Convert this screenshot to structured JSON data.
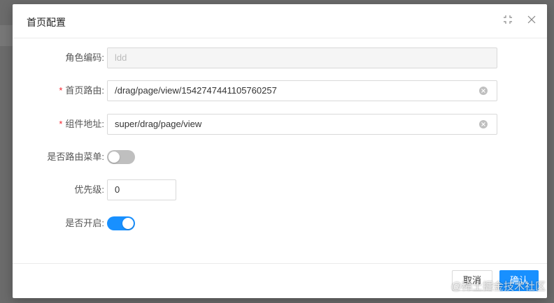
{
  "dialog": {
    "title": "首页配置"
  },
  "form": {
    "role_code": {
      "label": "角色编码:",
      "value": "ldd",
      "disabled": true
    },
    "home_route": {
      "label": "首页路由:",
      "required": true,
      "value": "/drag/page/view/1542747441105760257"
    },
    "component_address": {
      "label": "组件地址:",
      "required": true,
      "value": "super/drag/page/view"
    },
    "is_route_menu": {
      "label": "是否路由菜单:",
      "on": false
    },
    "priority": {
      "label": "优先级:",
      "value": "0"
    },
    "enabled": {
      "label": "是否开启:",
      "on": true
    }
  },
  "footer": {
    "cancel_label": "取消",
    "ok_label": "确认"
  },
  "watermark": "@稀土掘金技术社区",
  "colors": {
    "primary": "#1890ff",
    "switch_off": "#bfbfbf",
    "required": "#f5222d"
  },
  "icons": {
    "fullscreen": "fullscreen-exit-icon",
    "close": "close-icon",
    "clear": "close-circle-icon"
  }
}
